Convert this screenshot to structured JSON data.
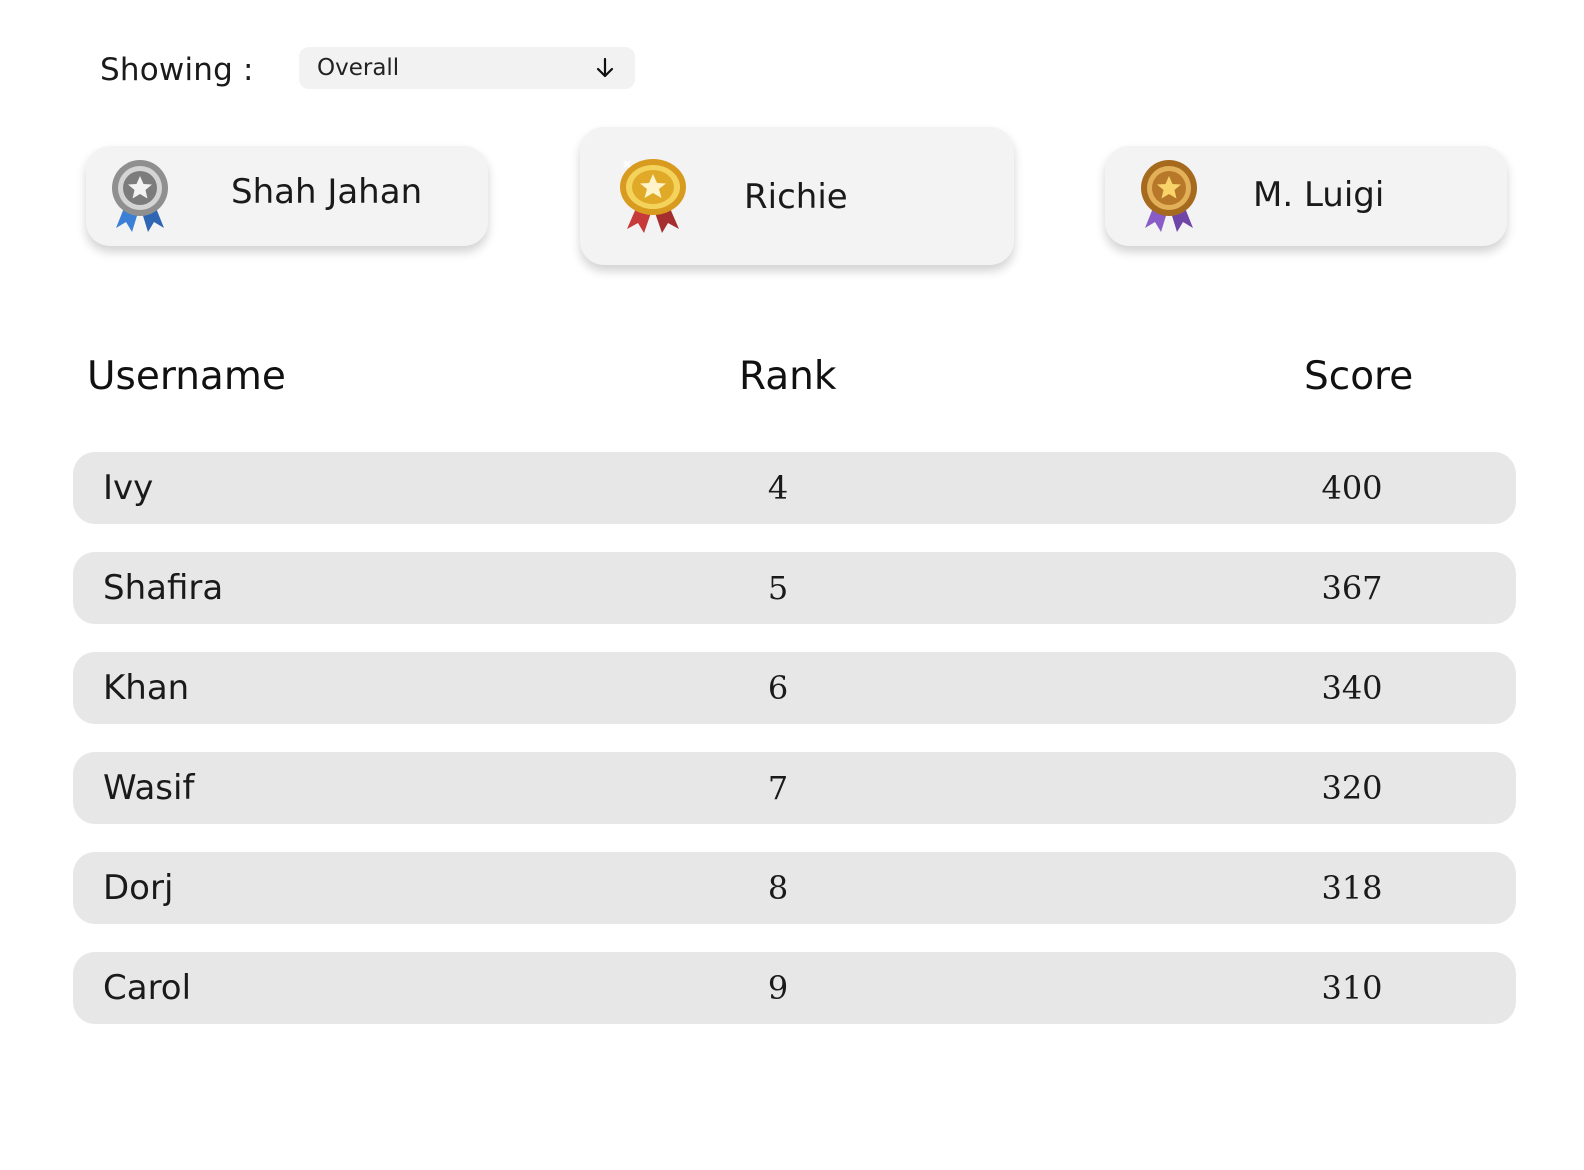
{
  "filter": {
    "label": "Showing :",
    "selected": "Overall",
    "icon": "arrow-down-icon"
  },
  "podium": {
    "first": {
      "name": "Richie",
      "medal": "gold",
      "medal_color": "#e9b82f",
      "ribbon_color": "#c63a3a",
      "icon": "gold-medal-icon"
    },
    "second": {
      "name": "Shah Jahan",
      "medal": "silver",
      "medal_color": "#a7a7a7",
      "ribbon_color": "#3b7fd6",
      "icon": "silver-medal-icon"
    },
    "third": {
      "name": "M. Luigi",
      "medal": "bronze",
      "medal_color": "#c88a2e",
      "ribbon_color": "#8a5cc7",
      "icon": "bronze-medal-icon"
    }
  },
  "table": {
    "headers": {
      "username": "Username",
      "rank": "Rank",
      "score": "Score"
    },
    "rows": [
      {
        "username": "Ivy",
        "rank": "4",
        "score": "400"
      },
      {
        "username": "Shafira",
        "rank": "5",
        "score": "367"
      },
      {
        "username": "Khan",
        "rank": "6",
        "score": "340"
      },
      {
        "username": "Wasif",
        "rank": "7",
        "score": "320"
      },
      {
        "username": "Dorj",
        "rank": "8",
        "score": "318"
      },
      {
        "username": "Carol",
        "rank": "9",
        "score": "310"
      }
    ]
  },
  "colors": {
    "card_bg": "#f3f3f3",
    "row_bg": "#e7e7e7",
    "select_bg": "#f2f2f2"
  }
}
